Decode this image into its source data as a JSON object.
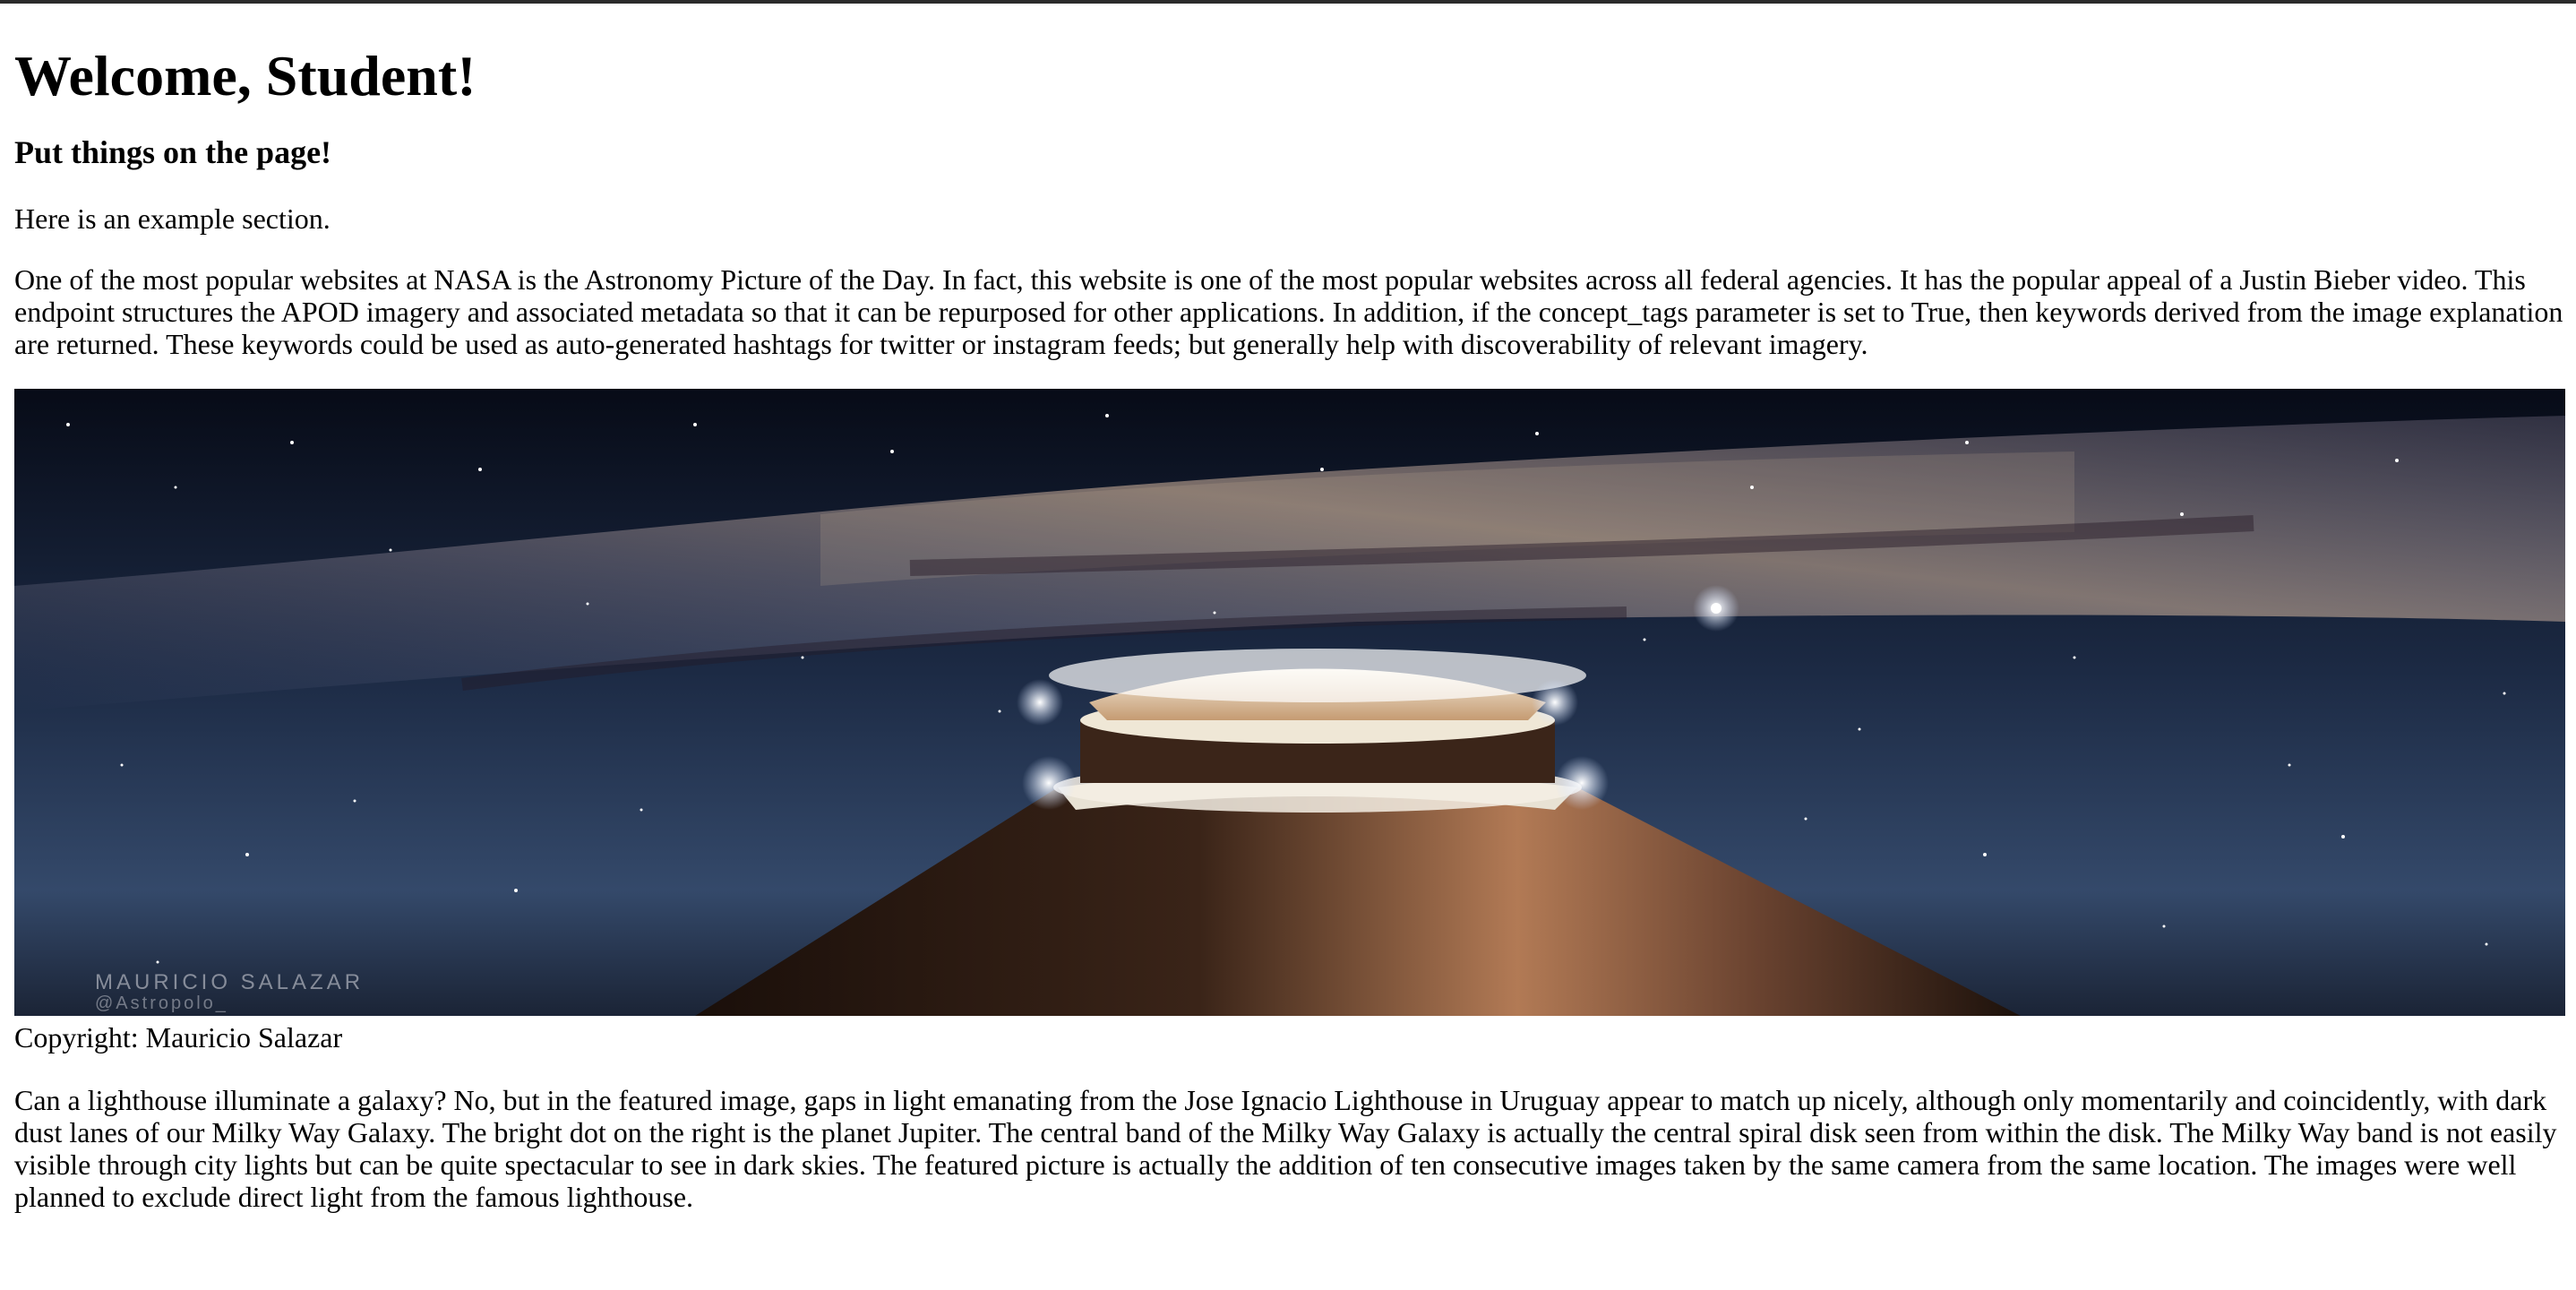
{
  "page": {
    "heading": "Welcome, Student!",
    "subheading": "Put things on the page!",
    "intro": "Here is an example section."
  },
  "description": "One of the most popular websites at NASA is the Astronomy Picture of the Day. In fact, this website is one of the most popular websites across all federal agencies. It has the popular appeal of a Justin Bieber video. This endpoint structures the APOD imagery and associated metadata so that it can be repurposed for other applications. In addition, if the concept_tags parameter is set to True, then keywords derived from the image explanation are returned. These keywords could be used as auto-generated hashtags for twitter or instagram feeds; but generally help with discoverability of relevant imagery.",
  "apod": {
    "watermark_line1": "MAURICIO SALAZAR",
    "watermark_line2": "@Astropolo_",
    "copyright": "Copyright: Mauricio Salazar",
    "explanation": "Can a lighthouse illuminate a galaxy? No, but in the featured image, gaps in light emanating from the Jose Ignacio Lighthouse in Uruguay appear to match up nicely, although only momentarily and coincidently, with dark dust lanes of our Milky Way Galaxy. The bright dot on the right is the planet Jupiter. The central band of the Milky Way Galaxy is actually the central spiral disk seen from within the disk. The Milky Way band is not easily visible through city lights but can be quite spectacular to see in dark skies. The featured picture is actually the addition of ten consecutive images taken by the same camera from the same location. The images were well planned to exclude direct light from the famous lighthouse."
  },
  "colors": {
    "sky_top": "#0a0f1e",
    "sky_bottom": "#3d5577",
    "tower": "#2b1a12",
    "tower_lit": "#b7805a"
  }
}
